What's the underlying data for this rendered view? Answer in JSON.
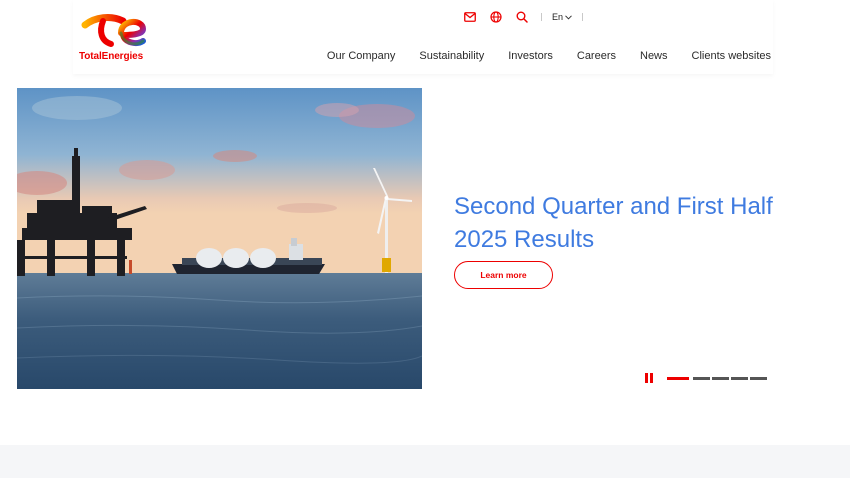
{
  "brand": {
    "name": "TotalEnergies",
    "color": "#ED0000"
  },
  "utility": {
    "icons": [
      "mail-icon",
      "globe-icon",
      "search-icon"
    ],
    "language": "En"
  },
  "nav": {
    "items": [
      "Our Company",
      "Sustainability",
      "Investors",
      "Careers",
      "News",
      "Clients websites"
    ]
  },
  "hero": {
    "title": "Second Quarter and First Half 2025 Results",
    "cta_label": "Learn more",
    "title_color": "#3F7BE0"
  },
  "carousel": {
    "slide_count": 5,
    "active_index": 0
  }
}
